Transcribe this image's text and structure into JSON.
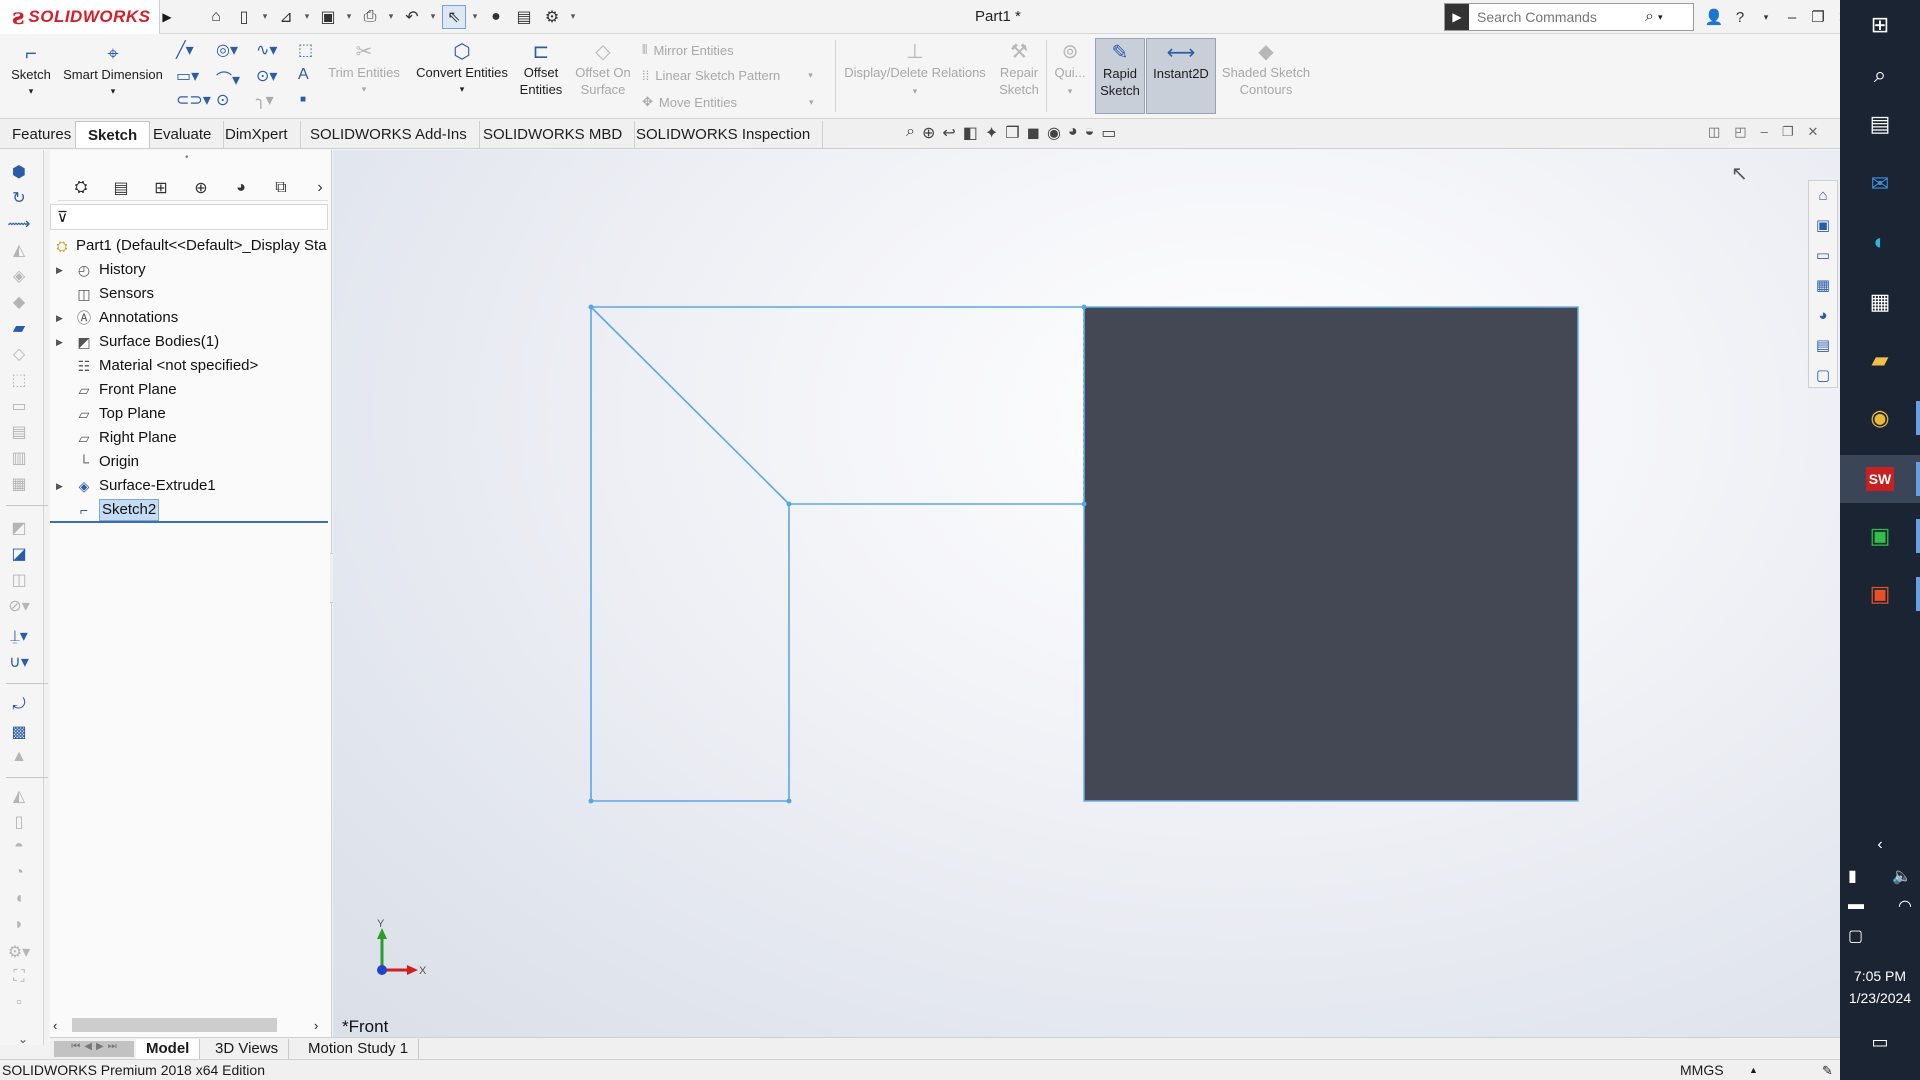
{
  "app": {
    "brand": "SOLIDWORKS",
    "document_title": "Part1 *",
    "search_placeholder": "Search Commands"
  },
  "command_manager": {
    "sketch": "Sketch",
    "smart_dimension": "Smart Dimension",
    "trim_entities": "Trim Entities",
    "convert_entities": "Convert Entities",
    "offset_entities_1": "Offset",
    "offset_entities_2": "Entities",
    "offset_on_surface_1": "Offset On",
    "offset_on_surface_2": "Surface",
    "mirror_entities": "Mirror Entities",
    "linear_sketch_pattern": "Linear Sketch Pattern",
    "move_entities": "Move Entities",
    "display_delete_relations": "Display/Delete Relations",
    "repair_sketch_1": "Repair",
    "repair_sketch_2": "Sketch",
    "quick_snaps": "Qui...",
    "rapid_sketch_1": "Rapid",
    "rapid_sketch_2": "Sketch",
    "instant2d": "Instant2D",
    "shaded_contours_1": "Shaded Sketch",
    "shaded_contours_2": "Contours"
  },
  "tabs": [
    "Features",
    "Sketch",
    "Evaluate",
    "DimXpert",
    "SOLIDWORKS Add-Ins",
    "SOLIDWORKS MBD",
    "SOLIDWORKS Inspection"
  ],
  "active_tab": "Sketch",
  "feature_tree": {
    "root": "Part1  (Default<<Default>_Display Sta",
    "items": [
      {
        "label": "History",
        "icon": "history-icon",
        "expandable": true
      },
      {
        "label": "Sensors",
        "icon": "sensors-icon",
        "expandable": false
      },
      {
        "label": "Annotations",
        "icon": "annotations-icon",
        "expandable": true
      },
      {
        "label": "Surface Bodies(1)",
        "icon": "surface-bodies-icon",
        "expandable": true
      },
      {
        "label": "Material <not specified>",
        "icon": "material-icon",
        "expandable": false
      },
      {
        "label": "Front Plane",
        "icon": "plane-icon",
        "expandable": false
      },
      {
        "label": "Top Plane",
        "icon": "plane-icon",
        "expandable": false
      },
      {
        "label": "Right Plane",
        "icon": "plane-icon",
        "expandable": false
      },
      {
        "label": "Origin",
        "icon": "origin-icon",
        "expandable": false
      },
      {
        "label": "Surface-Extrude1",
        "icon": "surface-extrude-icon",
        "expandable": true
      },
      {
        "label": "Sketch2",
        "icon": "sketch-icon",
        "expandable": false,
        "selected": true
      }
    ]
  },
  "graphics": {
    "view_name": "*Front",
    "triad_y": "Y",
    "triad_x": "X"
  },
  "bottom_tabs": [
    "Model",
    "3D Views",
    "Motion Study 1"
  ],
  "status": {
    "edition": "SOLIDWORKS Premium 2018 x64 Edition",
    "units": "MMGS"
  },
  "taskbar": {
    "time": "7:05 PM",
    "date": "1/23/2024",
    "sw_badge": "SW"
  },
  "colors": {
    "sketch_line": "#5aa7e6",
    "surface_fill": "#444855",
    "brand_red": "#d1202a",
    "taskbar_bg": "#1b2433"
  }
}
